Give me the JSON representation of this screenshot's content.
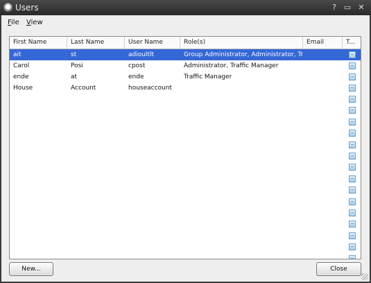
{
  "window": {
    "title": "Users",
    "controls": [
      "?",
      "▭",
      "✕"
    ]
  },
  "menu": [
    {
      "label": "File",
      "mnemonic": "F",
      "rest": "ile"
    },
    {
      "label": "View",
      "mnemonic": "V",
      "rest": "iew"
    }
  ],
  "table": {
    "columns": [
      "First Name",
      "Last Name",
      "User Name",
      "Role(s)",
      "Email",
      "T..."
    ],
    "rows": [
      {
        "first": "ait",
        "last": "st",
        "user": "adioultlt",
        "roles": "Group Administrator, Administrator, Tr...",
        "email": "",
        "checked": false,
        "selected": true
      },
      {
        "first": "Carol",
        "last": "Posi",
        "user": "cpost",
        "roles": "Administrator, Traffic Manager",
        "email": "",
        "checked": false,
        "selected": false
      },
      {
        "first": "ende",
        "last": "at",
        "user": "ende",
        "roles": "Traffic Manager",
        "email": "",
        "checked": false,
        "selected": false
      },
      {
        "first": "House",
        "last": "Account",
        "user": "houseaccount",
        "roles": "",
        "email": "",
        "checked": false,
        "selected": false
      }
    ],
    "extra_checkboxes": [
      false,
      false,
      false,
      false,
      false,
      false,
      false,
      false,
      false,
      false,
      false,
      false,
      false,
      false,
      false,
      false,
      true
    ]
  },
  "buttons": {
    "new_label": "New...",
    "close_label": "Close"
  }
}
